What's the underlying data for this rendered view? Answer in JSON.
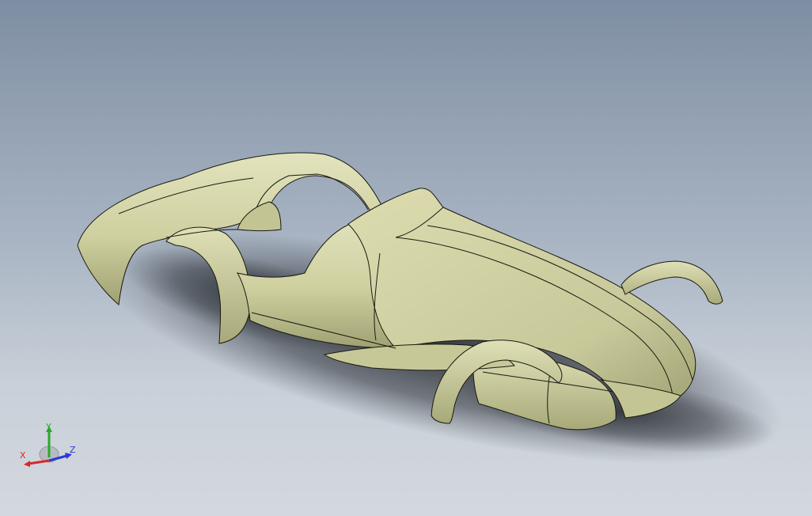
{
  "viewport": {
    "background_top": "#7e8ea2",
    "background_bottom": "#d3d8de",
    "model_color": "#d3d5a8",
    "model_shade": "#aeb07e",
    "edge_color": "#1a1a10"
  },
  "triad": {
    "x_label": "X",
    "y_label": "Y",
    "z_label": "Z",
    "x_color": "#d42a2a",
    "y_color": "#2aa82a",
    "z_color": "#2a3ad4"
  }
}
